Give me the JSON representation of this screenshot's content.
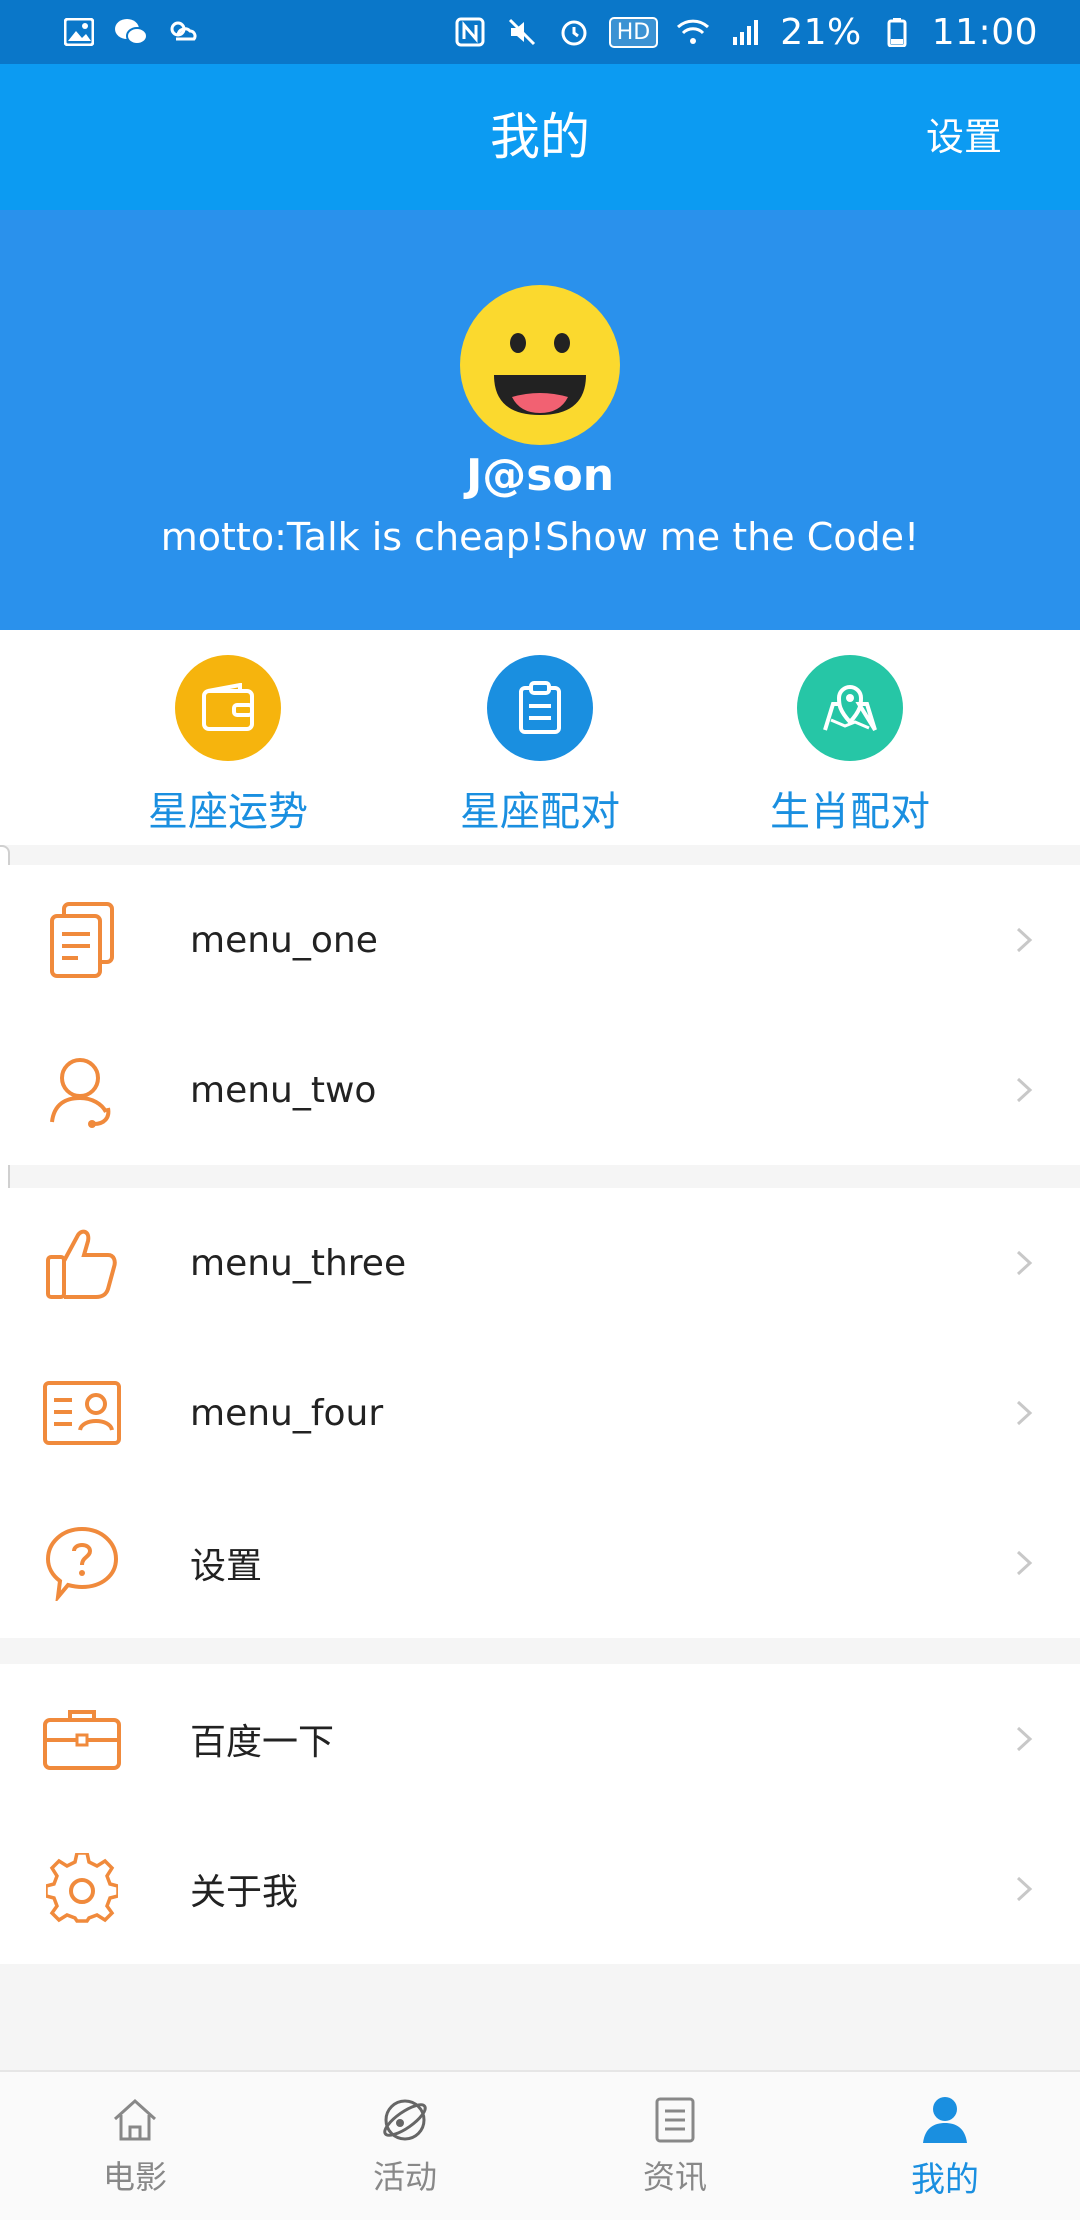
{
  "status_bar": {
    "battery": "21%",
    "time": "11:00",
    "hd": "HD",
    "icons_left": [
      "image-icon",
      "wechat-icon",
      "weather-icon"
    ],
    "icons_right": [
      "nfc-icon",
      "mute-icon",
      "alarm-icon",
      "hd-icon",
      "wifi-icon",
      "signal-icon",
      "battery-icon"
    ]
  },
  "header": {
    "title": "我的",
    "action": "设置"
  },
  "profile": {
    "name": "J@son",
    "motto": "motto:Talk is cheap!Show me the Code!"
  },
  "quick_actions": [
    {
      "label": "星座运势",
      "icon": "wallet-icon",
      "color": "#f6b40d"
    },
    {
      "label": "星座配对",
      "icon": "clipboard-icon",
      "color": "#1a8fe0"
    },
    {
      "label": "生肖配对",
      "icon": "map-pin-icon",
      "color": "#26c6a6"
    }
  ],
  "menu_sections": [
    {
      "items": [
        {
          "label": "menu_one",
          "icon": "document-icon"
        },
        {
          "label": "menu_two",
          "icon": "user-headset-icon"
        }
      ]
    },
    {
      "items": [
        {
          "label": "menu_three",
          "icon": "thumbs-up-icon"
        },
        {
          "label": "menu_four",
          "icon": "contact-card-icon"
        },
        {
          "label": "设置",
          "icon": "help-bubble-icon"
        }
      ]
    },
    {
      "items": [
        {
          "label": "百度一下",
          "icon": "briefcase-icon"
        },
        {
          "label": "关于我",
          "icon": "gear-icon"
        }
      ]
    }
  ],
  "tabs": [
    {
      "label": "电影",
      "icon": "home-icon",
      "active": false
    },
    {
      "label": "活动",
      "icon": "planet-icon",
      "active": false
    },
    {
      "label": "资讯",
      "icon": "news-icon",
      "active": false
    },
    {
      "label": "我的",
      "icon": "person-icon",
      "active": true
    }
  ],
  "colors": {
    "status_bar": "#0a77c9",
    "title_bar": "#0c9bf2",
    "profile_bg": "#2a91ec",
    "accent": "#1a8fe0",
    "menu_icon": "#f08a3c"
  }
}
